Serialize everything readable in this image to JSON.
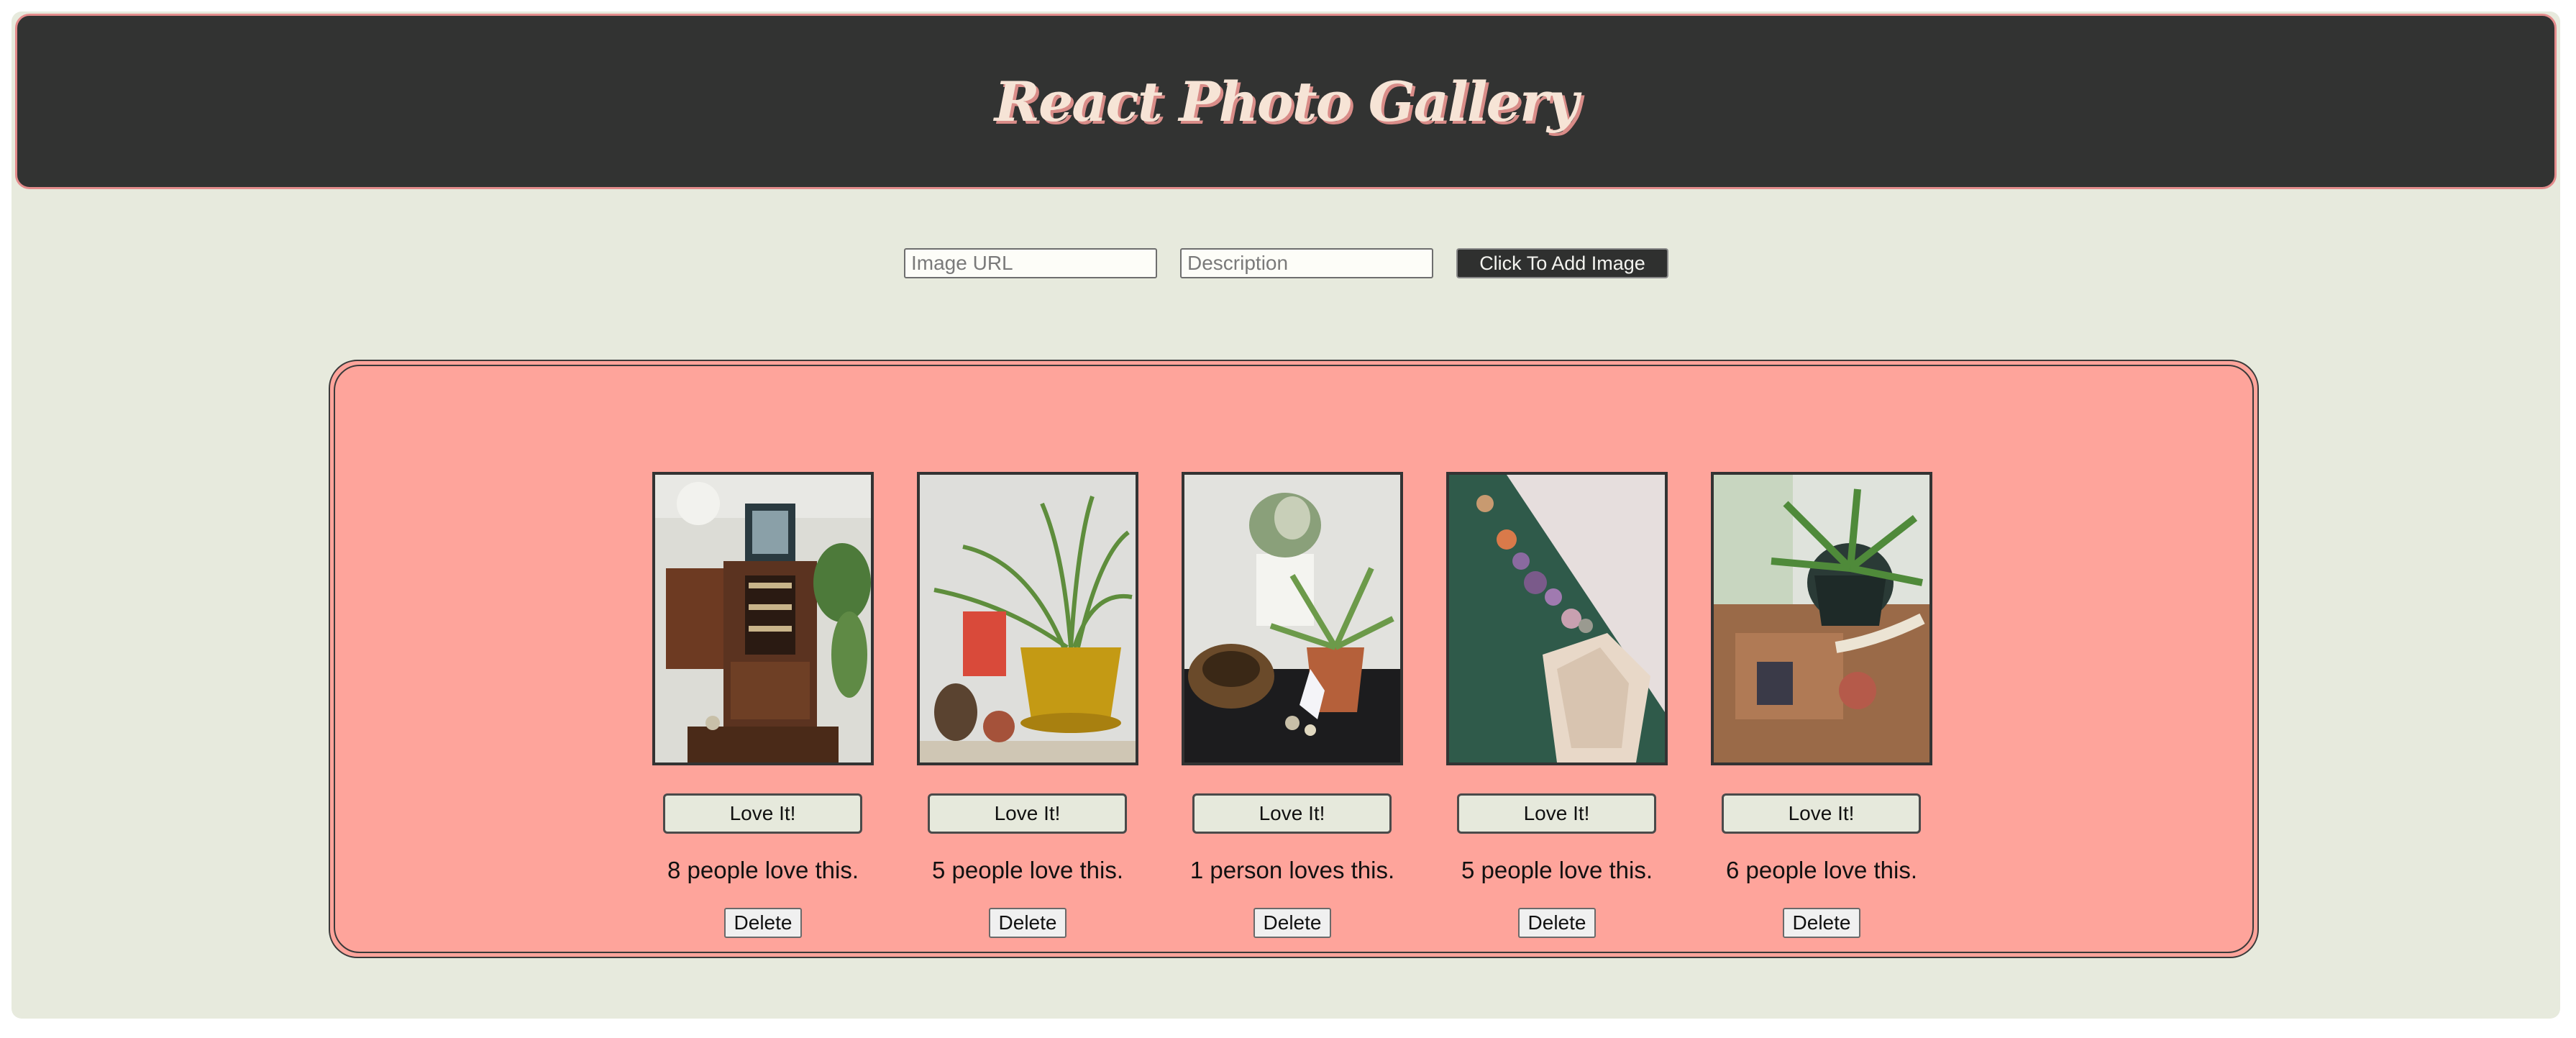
{
  "header": {
    "title": "React Photo Gallery"
  },
  "form": {
    "url_placeholder": "Image URL",
    "desc_placeholder": "Description",
    "add_label": "Click To Add Image"
  },
  "gallery": {
    "cards": [
      {
        "love_label": "Love It!",
        "count_text": "8 people love this.",
        "delete_label": "Delete"
      },
      {
        "love_label": "Love It!",
        "count_text": "5 people love this.",
        "delete_label": "Delete"
      },
      {
        "love_label": "Love It!",
        "count_text": "1 person loves this.",
        "delete_label": "Delete"
      },
      {
        "love_label": "Love It!",
        "count_text": "5 people love this.",
        "delete_label": "Delete"
      },
      {
        "love_label": "Love It!",
        "count_text": "6 people love this.",
        "delete_label": "Delete"
      }
    ]
  },
  "colors": {
    "page_bg": "#e7eadd",
    "header_bg": "#323332",
    "gallery_bg": "#fea49b",
    "title_color": "#f6e4d6",
    "title_shadow": "#d98c88"
  }
}
